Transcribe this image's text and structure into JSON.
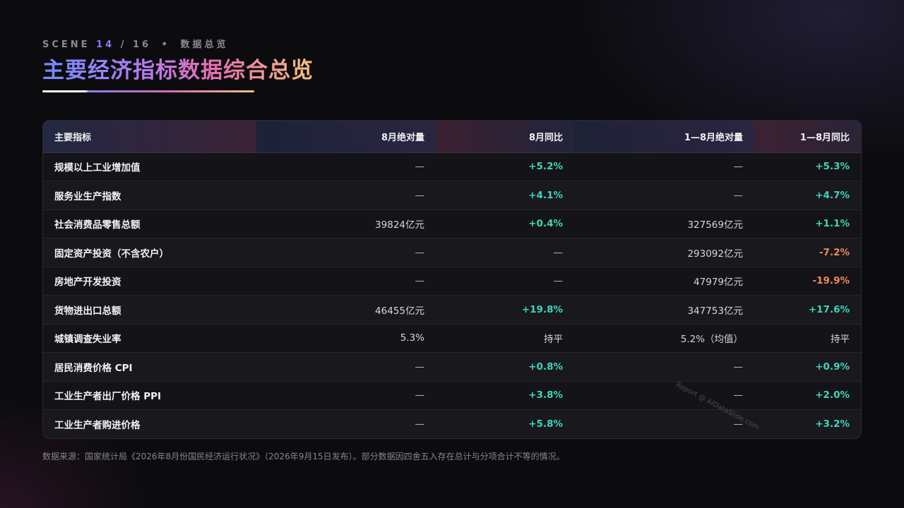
{
  "scene": {
    "label": "SCENE",
    "current": "14",
    "separator": "/",
    "total": "16",
    "section": "数据总览"
  },
  "title": "主要经济指标数据综合总览",
  "table": {
    "headers": [
      "主要指标",
      "8月绝对量",
      "8月同比",
      "1—8月绝对量",
      "1—8月同比"
    ],
    "rows": [
      [
        "规模以上工业增加值",
        "—",
        "+5.2%",
        "—",
        "+5.3%"
      ],
      [
        "服务业生产指数",
        "—",
        "+4.1%",
        "—",
        "+4.7%"
      ],
      [
        "社会消费品零售总额",
        "39824亿元",
        "+0.4%",
        "327569亿元",
        "+1.1%"
      ],
      [
        "固定资产投资（不含农户）",
        "—",
        "—",
        "293092亿元",
        "-7.2%"
      ],
      [
        "房地产开发投资",
        "—",
        "—",
        "47979亿元",
        "-19.9%"
      ],
      [
        "货物进出口总额",
        "46455亿元",
        "+19.8%",
        "347753亿元",
        "+17.6%"
      ],
      [
        "城镇调查失业率",
        "5.3%",
        "持平",
        "5.2%（均值）",
        "持平"
      ],
      [
        "居民消费价格 CPI",
        "—",
        "+0.8%",
        "—",
        "+0.9%"
      ],
      [
        "工业生产者出厂价格 PPI",
        "—",
        "+3.8%",
        "—",
        "+2.0%"
      ],
      [
        "工业生产者购进价格",
        "—",
        "+5.8%",
        "—",
        "+3.2%"
      ]
    ]
  },
  "watermark": "Report @ AIDataSlide.com",
  "source": "数据来源：国家统计局《2026年8月份国民经济运行状况》（2026年9月15日发布）。部分数据因四舍五入存在总计与分项合计不等的情况。",
  "colors": {
    "positive": "#3fd6b8",
    "negative": "#f08a5a",
    "accent": "#8f7cf0"
  }
}
